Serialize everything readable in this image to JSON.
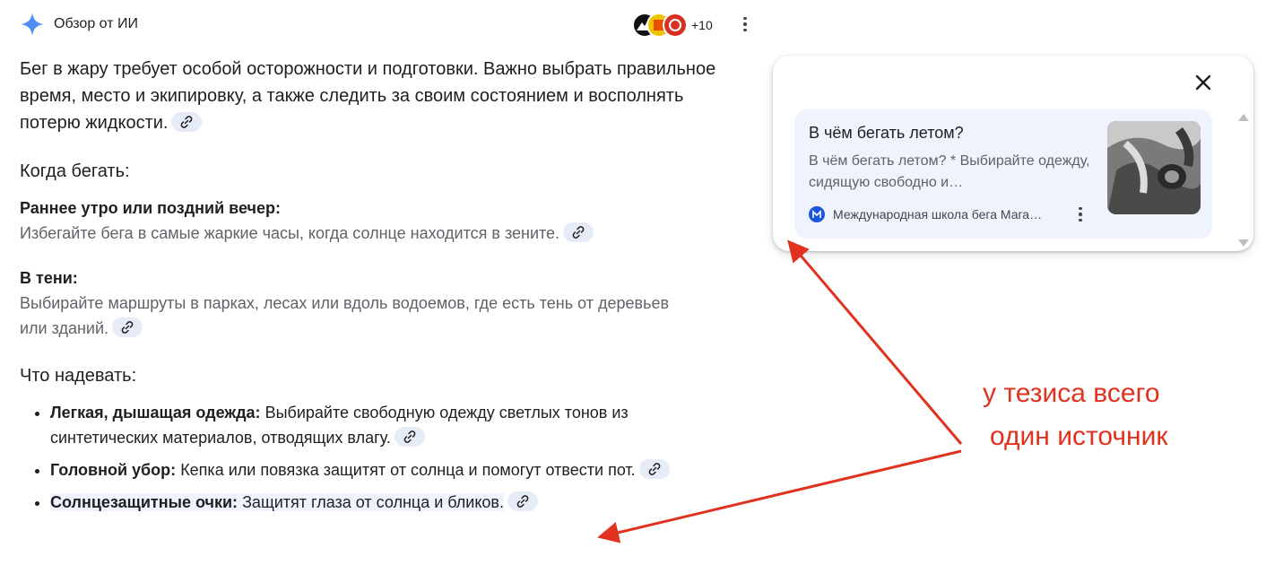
{
  "header": {
    "title": "Обзор от ИИ",
    "sources_more": "+10",
    "spark_color": "#4c8df6"
  },
  "intro": {
    "text": "Бег в жару требует особой осторожности и подготовки. Важно выбрать правильное время, место и экипировку, а также следить за своим состоянием и восполнять потерю жидкости."
  },
  "when": {
    "heading": "Когда бегать:",
    "items": [
      {
        "title": "Раннее утро или поздний вечер:",
        "text": "Избегайте бега в самые жаркие часы, когда солнце находится в зените."
      },
      {
        "title": "В тени:",
        "text": "Выбирайте маршруты в парках, лесах или вдоль водоемов, где есть тень от деревьев или зданий."
      }
    ]
  },
  "wear": {
    "heading": "Что надевать:",
    "items": [
      {
        "title": "Легкая, дышащая одежда:",
        "text": "Выбирайте свободную одежду светлых тонов из синтетических материалов, отводящих влагу."
      },
      {
        "title": "Головной убор:",
        "text": "Кепка или повязка защитят от солнца и помогут отвести пот."
      },
      {
        "title": "Солнцезащитные очки:",
        "text": "Защитят глаза от солнца и бликов."
      }
    ]
  },
  "popup": {
    "card": {
      "title": "В чём бегать летом?",
      "snippet": "В чём бегать летом? * Выбирайте одежду, сидящую свободно и…",
      "source": "Международная школа бега Мага…"
    }
  },
  "annotation": {
    "line1": "у тезиса всего",
    "line2": "один источник",
    "color": "#e0321f"
  }
}
